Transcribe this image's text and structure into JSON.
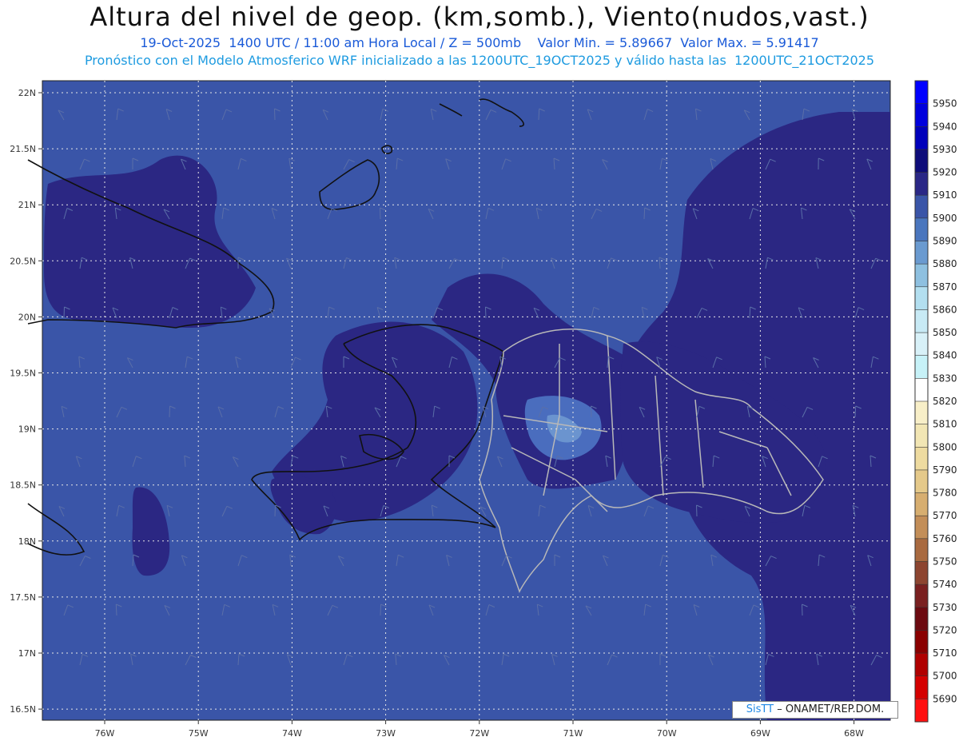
{
  "header": {
    "title": "Altura del nivel de geop. (km,somb.), Viento(nudos,vast.)",
    "subtitle": "19-Oct-2025  1400 UTC / 11:00 am Hora Local / Z = 500mb    Valor Min. = 5.89667  Valor Max. = 5.91417",
    "subtitle2": "Pronóstico con el Modelo Atmosferico WRF inicializado a las 1200UTC_19OCT2025 y válido hasta las  1200UTC_21OCT2025"
  },
  "map": {
    "lat_labels": [
      "22N",
      "21.5N",
      "21N",
      "20.5N",
      "20N",
      "19.5N",
      "19N",
      "18.5N",
      "18N",
      "17.5N",
      "17N",
      "16.5N"
    ],
    "lon_labels": [
      "76W",
      "75W",
      "74W",
      "73W",
      "72W",
      "71W",
      "70W",
      "69W",
      "68W"
    ],
    "background_color": "#3a55a8",
    "higher_color": "#2b2783",
    "lower_color": "#4a6dbe",
    "lowest_color": "#6b94cf"
  },
  "colorbar": {
    "levels": [
      "5950",
      "5940",
      "5930",
      "5920",
      "5910",
      "5900",
      "5890",
      "5880",
      "5870",
      "5860",
      "5850",
      "5840",
      "5830",
      "5820",
      "5810",
      "5800",
      "5790",
      "5780",
      "5770",
      "5760",
      "5750",
      "5740",
      "5730",
      "5720",
      "5710",
      "5700",
      "5690"
    ],
    "colors": [
      "#0000ff",
      "#0000dd",
      "#0000bb",
      "#0e0c7a",
      "#2a2786",
      "#3a55a8",
      "#4a76be",
      "#6a9ad0",
      "#8ec0e0",
      "#b3dff0",
      "#c8eaf5",
      "#d8f1f8",
      "#c7f2f8",
      "#ffffff",
      "#f8efc8",
      "#f2e6b4",
      "#eedba0",
      "#e5c98a",
      "#d7ae70",
      "#c38e58",
      "#a96a40",
      "#8d4530",
      "#7a2020",
      "#6c0a10",
      "#8a0000",
      "#b00000",
      "#d40000",
      "#ff1010"
    ]
  },
  "credit": {
    "brand": "SisTT",
    "text": " – ONAMET/REP.DOM."
  }
}
